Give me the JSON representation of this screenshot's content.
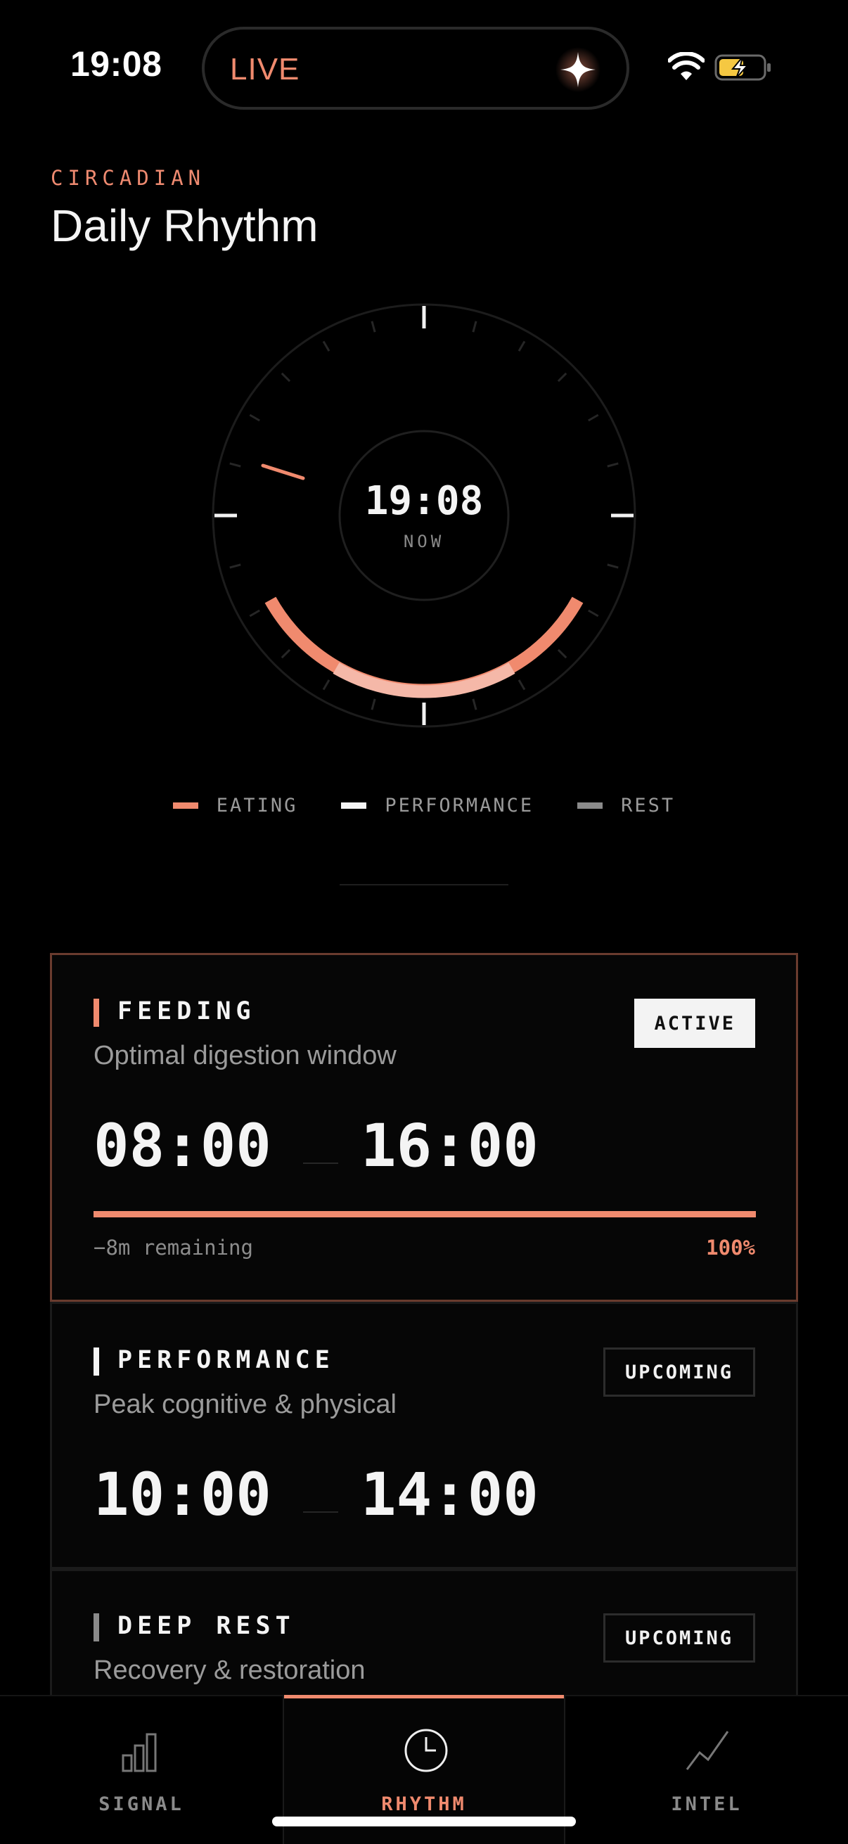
{
  "status": {
    "time": "19:08",
    "island_label": "LIVE"
  },
  "header": {
    "eyebrow": "CIRCADIAN",
    "title": "Daily Rhythm"
  },
  "dial": {
    "time": "19:08",
    "sub": "NOW"
  },
  "legend": [
    {
      "label": "EATING",
      "color": "#f08a6e"
    },
    {
      "label": "PERFORMANCE",
      "color": "#f4f4f4"
    },
    {
      "label": "REST",
      "color": "#8a8a8a"
    }
  ],
  "cards": [
    {
      "name": "FEEDING",
      "desc": "Optimal digestion window",
      "badge": "ACTIVE",
      "start": "08:00",
      "end": "16:00",
      "remaining": "−8m remaining",
      "percent": "100%",
      "progress": 1.0,
      "accent": "#f08a6e"
    },
    {
      "name": "PERFORMANCE",
      "desc": "Peak cognitive & physical",
      "badge": "UPCOMING",
      "start": "10:00",
      "end": "14:00",
      "accent": "#f4f4f4"
    },
    {
      "name": "DEEP REST",
      "desc": "Recovery & restoration",
      "badge": "UPCOMING",
      "accent": "#8a8a8a"
    }
  ],
  "tabs": [
    {
      "label": "SIGNAL",
      "icon": "bar-chart-icon"
    },
    {
      "label": "RHYTHM",
      "icon": "clock-icon",
      "active": true
    },
    {
      "label": "INTEL",
      "icon": "trend-line-icon"
    }
  ]
}
